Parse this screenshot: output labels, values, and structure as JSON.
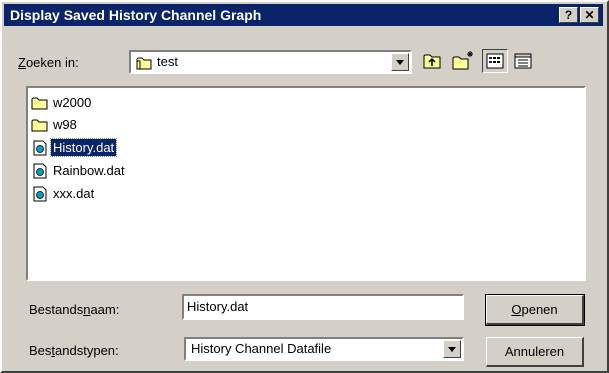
{
  "window": {
    "title": "Display Saved History Channel Graph",
    "help_glyph": "?",
    "close_glyph": "✕"
  },
  "lookin": {
    "label_pre": "",
    "label_ul": "Z",
    "label_post": "oeken in:",
    "value": "test",
    "icon": "folder-icon"
  },
  "toolbar": {
    "up": "up-one-level-icon",
    "newfolder": "new-folder-icon",
    "list": "list-view-icon",
    "details": "details-view-icon"
  },
  "files": [
    {
      "name": "w2000",
      "type": "folder",
      "selected": false
    },
    {
      "name": "w98",
      "type": "folder",
      "selected": false
    },
    {
      "name": "History.dat",
      "type": "file",
      "selected": true
    },
    {
      "name": "Rainbow.dat",
      "type": "file",
      "selected": false
    },
    {
      "name": "xxx.dat",
      "type": "file",
      "selected": false
    }
  ],
  "filename": {
    "label_pre": "Bestands",
    "label_ul": "n",
    "label_post": "aam:",
    "value": "History.dat"
  },
  "filetype": {
    "label_pre": "Bes",
    "label_ul": "t",
    "label_post": "andstypen:",
    "value": "History Channel Datafile"
  },
  "buttons": {
    "open_ul": "O",
    "open_post": "penen",
    "cancel": "Annuleren"
  },
  "colors": {
    "titlebar": "#0a246a",
    "face": "#d4d0c8",
    "selection": "#0a246a",
    "folder": "#ffff99"
  }
}
